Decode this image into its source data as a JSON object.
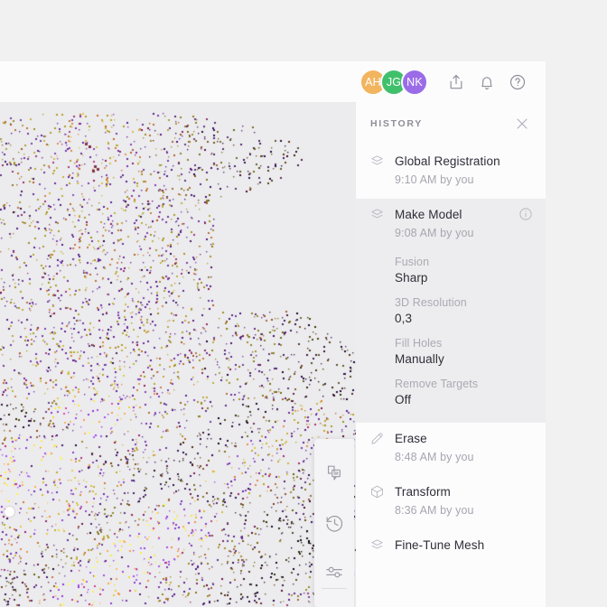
{
  "header": {
    "avatars": [
      {
        "initials": "AH",
        "color": "#f2b45e"
      },
      {
        "initials": "JG",
        "color": "#41c06c"
      },
      {
        "initials": "NK",
        "color": "#9a6ce8"
      }
    ],
    "actions": [
      {
        "name": "share-icon",
        "label": "Share"
      },
      {
        "name": "notifications-icon",
        "label": "Notifications"
      },
      {
        "name": "help-icon",
        "label": "Help"
      }
    ]
  },
  "panel": {
    "title": "HISTORY",
    "close_label": "Close",
    "items": [
      {
        "name": "Global Registration",
        "time": "9:10 AM by you",
        "icon": "layers-icon",
        "expanded": false,
        "has_info": false
      },
      {
        "name": "Make Model",
        "time": "9:08 AM by you",
        "icon": "layers-icon",
        "expanded": true,
        "has_info": true,
        "params": [
          {
            "key": "Fusion",
            "value": "Sharp"
          },
          {
            "key": "3D Resolution",
            "value": "0,3"
          },
          {
            "key": "Fill Holes",
            "value": "Manually"
          },
          {
            "key": "Remove Targets",
            "value": "Off"
          }
        ]
      },
      {
        "name": "Erase",
        "time": "8:48 AM by you",
        "icon": "pencil-icon",
        "expanded": false,
        "has_info": false
      },
      {
        "name": "Transform",
        "time": "8:36 AM by you",
        "icon": "cube-icon",
        "expanded": false,
        "has_info": false
      },
      {
        "name": "Fine-Tune Mesh",
        "time": "",
        "icon": "layers-icon",
        "expanded": false,
        "has_info": false
      }
    ]
  },
  "toolbar": {
    "buttons": [
      {
        "name": "comments-icon",
        "label": "Comments"
      },
      {
        "name": "history-icon",
        "label": "History"
      },
      {
        "name": "settings-icon",
        "label": "Settings"
      }
    ]
  },
  "viewport": {
    "background": "#ececef",
    "handle_label": "Rotation handle",
    "point_colors": [
      "#7a3fa8",
      "#b9a52f",
      "#c57a3c",
      "#5e2e86",
      "#e0c24a",
      "#8e2f6a"
    ]
  }
}
